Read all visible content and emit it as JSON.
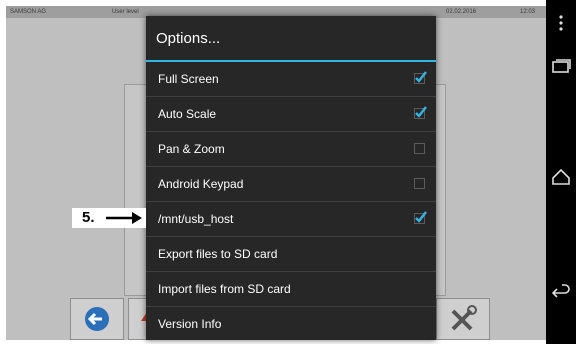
{
  "status_bar": {
    "company": "SAMSON AG",
    "user_level": "User level",
    "date": "02.02.2016",
    "time": "12:03"
  },
  "dialog": {
    "title": "Options...",
    "accent_color": "#33b5e5",
    "options": [
      {
        "label": "Full Screen",
        "checkbox": true,
        "checked": true
      },
      {
        "label": "Auto Scale",
        "checkbox": true,
        "checked": true
      },
      {
        "label": "Pan & Zoom",
        "checkbox": true,
        "checked": false
      },
      {
        "label": "Android Keypad",
        "checkbox": true,
        "checked": false
      },
      {
        "label": "/mnt/usb_host",
        "checkbox": true,
        "checked": true
      },
      {
        "label": "Export files to SD card",
        "checkbox": false
      },
      {
        "label": "Import files from SD card",
        "checkbox": false
      },
      {
        "label": "Version Info",
        "checkbox": false
      }
    ]
  },
  "callout": {
    "label": "5."
  },
  "toolbar": {
    "icons": [
      "back-arrow-icon",
      "up-arrow-icon",
      "tools-icon"
    ]
  },
  "nav_bar": {
    "icons": [
      "overflow-menu-icon",
      "recent-apps-icon",
      "home-icon",
      "back-icon"
    ]
  }
}
